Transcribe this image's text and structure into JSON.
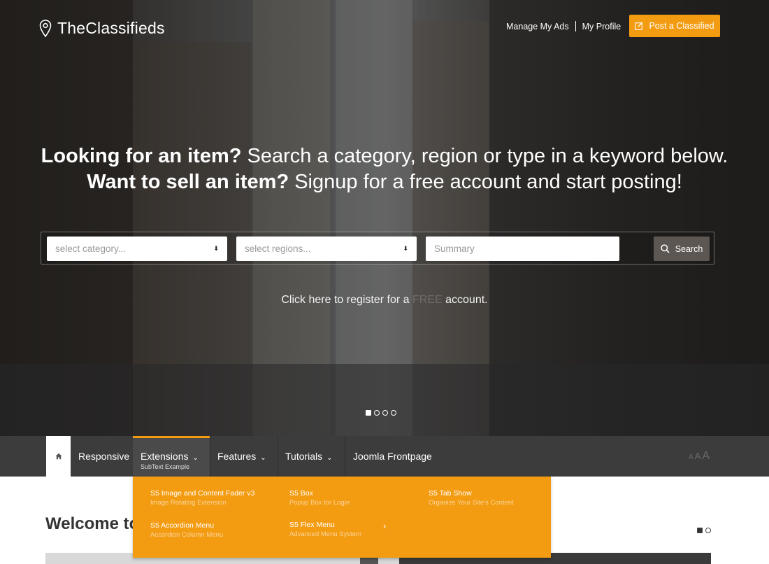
{
  "brand": {
    "prefix": "The",
    "name": "Classifieds"
  },
  "top_nav": {
    "manage_ads": "Manage My Ads",
    "my_profile": "My Profile"
  },
  "post_button": "Post a Classified",
  "headline": {
    "line1_bold": "Looking for an item?",
    "line1_rest": " Search a category, region or type in a keyword below.",
    "line2_bold": "Want to sell an item?",
    "line2_rest": " Signup for a free account and start posting!"
  },
  "search": {
    "category_placeholder": "select category...",
    "regions_placeholder": "select regions...",
    "summary_placeholder": "Summary",
    "button": "Search"
  },
  "register": {
    "before": "Click here to register for a ",
    "highlight": "FREE",
    "after": " account."
  },
  "slider": {
    "slides": 4,
    "active": 1
  },
  "menu": {
    "items": [
      {
        "label": "Responsive"
      },
      {
        "label": "Extensions",
        "sub": "SubText Example"
      },
      {
        "label": "Features"
      },
      {
        "label": "Tutorials"
      },
      {
        "label": "Joomla Frontpage"
      }
    ],
    "font_sizes": [
      "A",
      "A",
      "A"
    ]
  },
  "dropdown": {
    "items": [
      {
        "title": "S5 Image and Content Fader v3",
        "sub": "Image Rotating Extension"
      },
      {
        "title": "S5 Box",
        "sub": "Popup Box for Login"
      },
      {
        "title": "S5 Tab Show",
        "sub": "Organize Your Site's Content"
      },
      {
        "title": "S5 Accordion Menu",
        "sub": "Accordion Column Menu"
      },
      {
        "title": "S5 Flex Menu",
        "sub": "Advanced Menu System"
      }
    ]
  },
  "welcome": {
    "title": "Welcome to"
  },
  "colors": {
    "accent": "#f39c12",
    "menubar": "#3c3c3c",
    "search_button": "#5d5753"
  },
  "icons": [
    "location-pin-icon",
    "edit-icon",
    "search-icon",
    "home-icon",
    "chevron-down-icon",
    "chevron-right-icon"
  ]
}
